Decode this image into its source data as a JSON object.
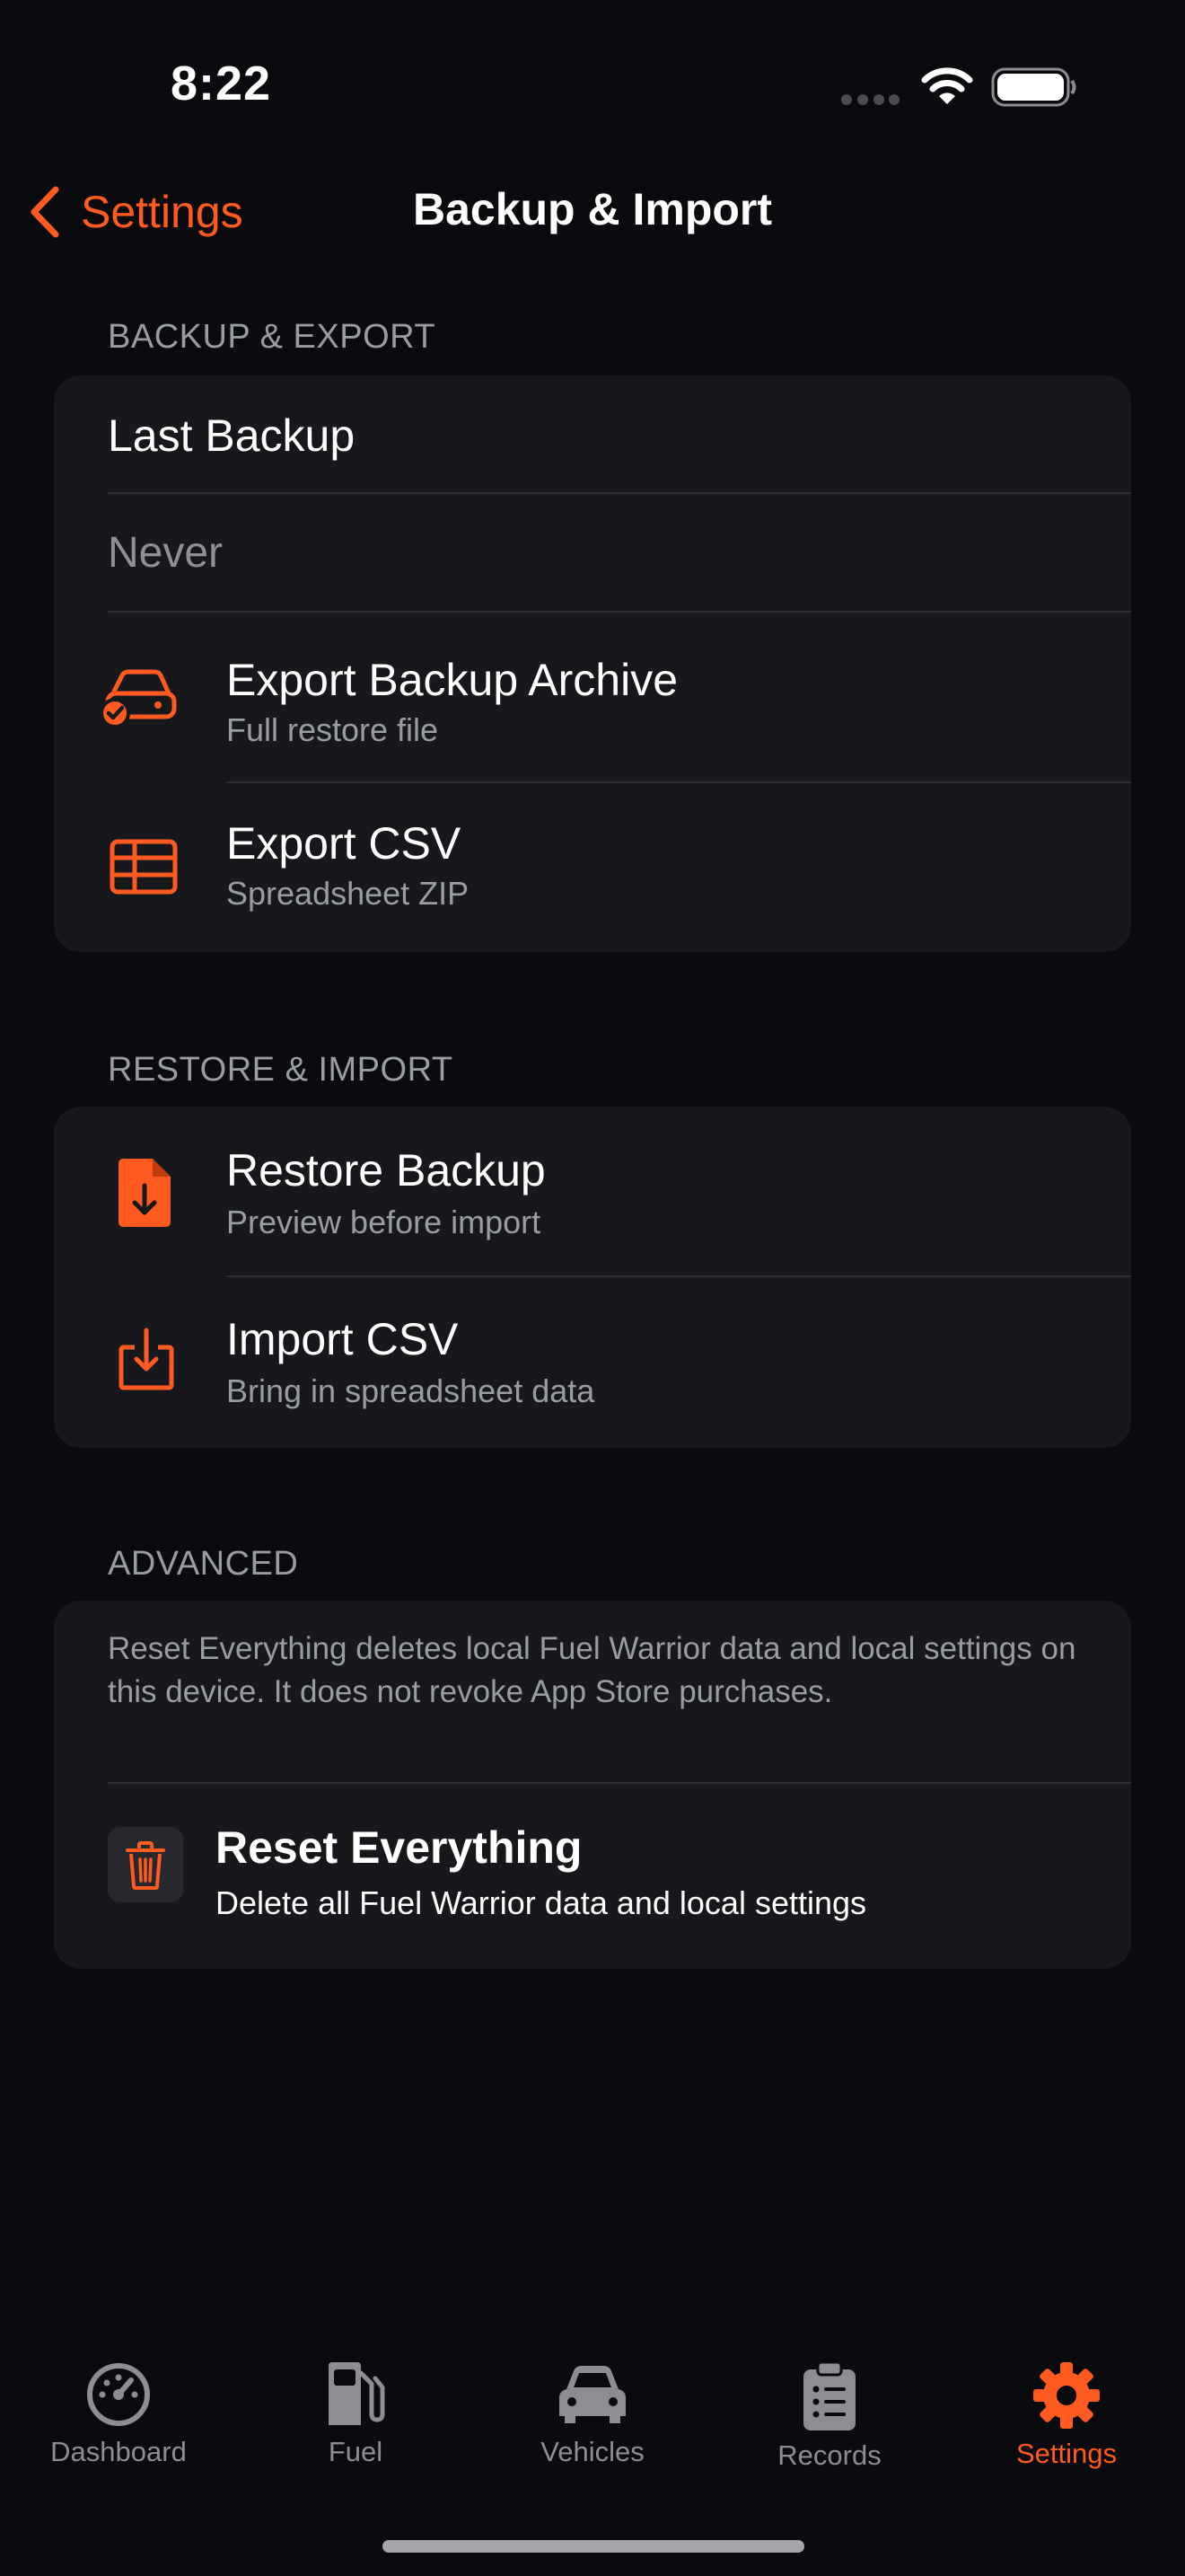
{
  "status_bar": {
    "time": "8:22"
  },
  "nav": {
    "back_label": "Settings",
    "title": "Backup & Import"
  },
  "backup_export": {
    "header": "BACKUP & EXPORT",
    "last_backup_label": "Last Backup",
    "last_backup_value": "Never",
    "export_archive": {
      "title": "Export Backup Archive",
      "subtitle": "Full restore file",
      "icon": "car-check-icon"
    },
    "export_csv": {
      "title": "Export CSV",
      "subtitle": "Spreadsheet ZIP",
      "icon": "table-icon"
    }
  },
  "restore_import": {
    "header": "RESTORE & IMPORT",
    "restore_backup": {
      "title": "Restore Backup",
      "subtitle": "Preview before import",
      "icon": "document-download-icon"
    },
    "import_csv": {
      "title": "Import CSV",
      "subtitle": "Bring in spreadsheet data",
      "icon": "tray-download-icon"
    }
  },
  "advanced": {
    "header": "ADVANCED",
    "description": "Reset Everything deletes local Fuel Warrior data and local settings on this device. It does not revoke App Store purchases.",
    "reset": {
      "title": "Reset Everything",
      "subtitle": "Delete all Fuel Warrior data and local settings",
      "icon": "trash-icon"
    }
  },
  "tab_bar": {
    "tabs": [
      {
        "label": "Dashboard",
        "icon": "speedometer-icon",
        "active": false
      },
      {
        "label": "Fuel",
        "icon": "fuel-pump-icon",
        "active": false
      },
      {
        "label": "Vehicles",
        "icon": "car-icon",
        "active": false
      },
      {
        "label": "Records",
        "icon": "clipboard-icon",
        "active": false
      },
      {
        "label": "Settings",
        "icon": "gear-icon",
        "active": true
      }
    ]
  },
  "colors": {
    "accent": "#ff5a1f",
    "background": "#0a0b0e",
    "card": "#16181c",
    "secondary_text": "#9a9ca3"
  }
}
